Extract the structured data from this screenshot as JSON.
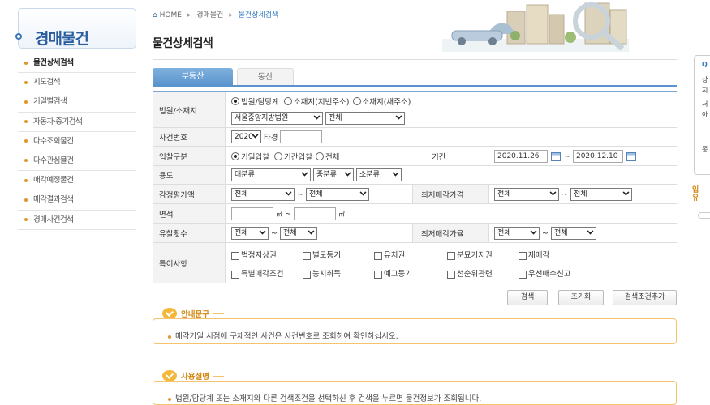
{
  "sidebar": {
    "title": "경매물건",
    "items": [
      {
        "label": "물건상세검색"
      },
      {
        "label": "지도검색"
      },
      {
        "label": "기일별검색"
      },
      {
        "label": "자동차·중기검색"
      },
      {
        "label": "다수조회물건"
      },
      {
        "label": "다수관심물건"
      },
      {
        "label": "매각예정물건"
      },
      {
        "label": "매각결과검색"
      },
      {
        "label": "경매사건검색"
      }
    ]
  },
  "breadcrumb": {
    "home": "HOME",
    "level1": "경매물건",
    "current": "물건상세검색"
  },
  "page_title": "물건상세검색",
  "tabs": {
    "realestate": "부동산",
    "movable": "동산"
  },
  "form": {
    "court": {
      "label": "법원/소재지",
      "radio1": "법원/담당계",
      "radio2": "소재지(지번주소)",
      "radio3": "소재지(새주소)",
      "court_select": "서울중앙지방법원",
      "dept_select": "전체"
    },
    "case_no": {
      "label": "사건번호",
      "year": "2020",
      "suffix": "타경",
      "value": ""
    },
    "bid_type": {
      "label": "입찰구분",
      "radio1": "기일입찰",
      "radio2": "기간입찰",
      "radio3": "전체",
      "period_label": "기간",
      "date_from": "2020.11.26",
      "tilde": "~",
      "date_to": "2020.12.10"
    },
    "usage": {
      "label": "용도",
      "major": "대분류",
      "middle": "중분류",
      "minor": "소분류"
    },
    "appraisal": {
      "label": "감정평가액",
      "from": "전체",
      "to": "전체",
      "min_price_label": "최저매각가격",
      "min_from": "전체",
      "min_to": "전체"
    },
    "area": {
      "label": "면적",
      "unit": "㎡"
    },
    "fail_count": {
      "label": "유찰횟수",
      "from": "전체",
      "to": "전체",
      "min_rate_label": "최저매각가율",
      "rate_from": "전체",
      "rate_to": "전체"
    },
    "special": {
      "label": "특이사항",
      "row1": [
        "법정지상권",
        "별도등기",
        "유치권",
        "분묘기지권",
        "재매각"
      ],
      "row2": [
        "특별매각조건",
        "농지취득",
        "예고등기",
        "선순위관련",
        "우선매수신고"
      ]
    }
  },
  "buttons": {
    "search": "검색",
    "reset": "초기화",
    "add_condition": "검색조건추가"
  },
  "notice": {
    "title": "안내문구",
    "text": "매각기일 시점에 구체적인 사건은 사건번호로 조회하여 확인하십시오."
  },
  "usage_guide": {
    "title": "사용설명",
    "text": "법원/담당계 또는 소재지와 다른 검색조건을 선택하신 후 검색을 누르면 물건정보가 조회됩니다."
  },
  "quick": {
    "head": "Q",
    "l1": "상",
    "l2": "지",
    "l3": "서",
    "l4": "아",
    "l5": "종",
    "promo": "입",
    "promo2": "유"
  },
  "colors": {
    "accent": "#5a93cd",
    "brand": "#2a5d9e",
    "notice": "#f3c36d"
  }
}
